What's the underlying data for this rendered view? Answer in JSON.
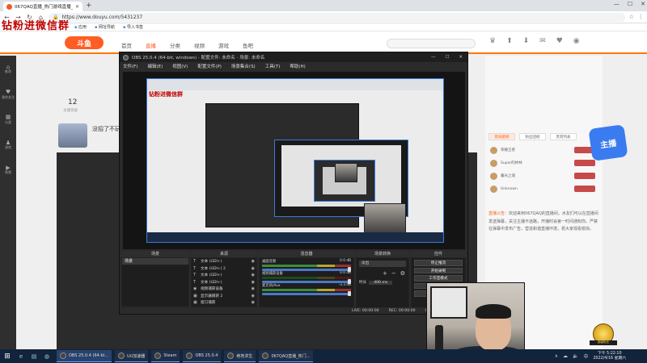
{
  "browser": {
    "tab_title": "067QAQ直播_热门游戏直播_斗鱼",
    "tab_close": "✕",
    "new_tab": "+",
    "window_controls": [
      "—",
      "☐",
      "✕"
    ],
    "nav_buttons": [
      "←",
      "→",
      "↻",
      "⌂"
    ],
    "url": "https://www.douyu.com/5431237",
    "toolbar_right": [
      "☆",
      "⋮"
    ],
    "bookmarks": [
      "应用",
      "网址导航",
      "导入书签"
    ]
  },
  "overlay": {
    "watermark": "钻粉进微信群"
  },
  "douyu": {
    "logo": "斗鱼",
    "nav": [
      "首页",
      "直播",
      "分类",
      "视频",
      "游戏",
      "鱼吧"
    ],
    "header_icons": [
      "♛",
      "⬆",
      "⬇",
      "✉",
      "♥",
      "◉"
    ],
    "sidebar": [
      {
        "icon": "⌂",
        "label": "推荐"
      },
      {
        "icon": "♥",
        "label": "我的关注"
      },
      {
        "icon": "▦",
        "label": "分类"
      },
      {
        "icon": "♟",
        "label": "游戏"
      },
      {
        "icon": "▶",
        "label": "视频"
      }
    ],
    "stat_number": "12",
    "stat_label": "主播等级",
    "title_peek": "没招了不玩",
    "rank_tabs": [
      "周贡献榜",
      "粉丝团榜",
      "贵宾列表"
    ],
    "rank_rows": [
      {
        "name": "荣耀王者"
      },
      {
        "name": "Super的林林"
      },
      {
        "name": "暮光之城"
      },
      {
        "name": "Unknown"
      }
    ],
    "notice_label": "直播公告：",
    "notice_text": "欢迎来到067QAQ的直播间，水友们可以在直播间发送弹幕，关注主播不迷路，开播时会第一时间通知你。严禁在弹幕中发布广告，营造和谐直播环境，祝大家观看愉快。",
    "promo_badge": "主播",
    "medal_label": "超级粉丝"
  },
  "obs": {
    "title": "OBS 25.0.4 (64-bit, windows) - 配置文件: 未命名 - 场景: 未命名",
    "window_controls": [
      "—",
      "☐",
      "✕"
    ],
    "menu": [
      "文件(F)",
      "编辑(E)",
      "视图(V)",
      "配置文件(P)",
      "场景集合(S)",
      "工具(T)",
      "帮助(H)"
    ],
    "nested_watermark": "钻粉进微信群",
    "docks": {
      "scenes": {
        "title": "场景",
        "items": [
          "场景"
        ],
        "footer": [
          "+",
          "−",
          "∧",
          "∨"
        ]
      },
      "sources": {
        "title": "来源",
        "items": [
          {
            "icon": "T",
            "label": "文本 (GDI+)"
          },
          {
            "icon": "T",
            "label": "文本 (GDI+) 2"
          },
          {
            "icon": "T",
            "label": "文本 (GDI+)"
          },
          {
            "icon": "T",
            "label": "文本 (GDI+)"
          },
          {
            "icon": "◉",
            "label": "视频捕获设备"
          },
          {
            "icon": "▣",
            "label": "显示器捕获 2"
          },
          {
            "icon": "▣",
            "label": "窗口捕获"
          }
        ],
        "footer": [
          "+",
          "−",
          "⚙",
          "∧",
          "∨"
        ]
      },
      "mixer": {
        "title": "混音器",
        "rows": [
          {
            "label": "桌面音频",
            "db": "0.0 dB",
            "low": false
          },
          {
            "label": "视频捕获设备",
            "db": "0.0 dB",
            "low": true
          },
          {
            "label": "麦克风/Aux",
            "db": "-3.3 dB",
            "low": false
          }
        ]
      },
      "transitions": {
        "title": "场景转换",
        "selected": "淡出",
        "footer": [
          "+",
          "−",
          "⚙"
        ],
        "duration_label": "时长",
        "duration": "400 ms"
      },
      "controls": {
        "title": "控件",
        "buttons": [
          "停止推流",
          "开始录制",
          "工作室模式",
          "设置",
          "退出"
        ]
      }
    },
    "status": [
      "LIVE: 00:00:00",
      "REC: 00:00:00",
      "CPU: 1.1%, 30.00 fps"
    ]
  },
  "taskbar": {
    "start": "⊞",
    "quick": [
      "e",
      "▤",
      "◍"
    ],
    "apps": [
      {
        "label": "OBS 25.0.4 (64-bi...",
        "active": true
      },
      {
        "label": "UU加速器",
        "active": false
      },
      {
        "label": "Steam",
        "active": false
      },
      {
        "label": "OBS 25.0.4",
        "active": false
      },
      {
        "label": "绝地求生",
        "active": false
      },
      {
        "label": "067QAQ直播_热门...",
        "active": false
      }
    ],
    "tray": [
      "∧",
      "☁",
      "🔈",
      "中"
    ],
    "time": "下午 5:22:10",
    "date": "2022/4/16 星期六"
  }
}
